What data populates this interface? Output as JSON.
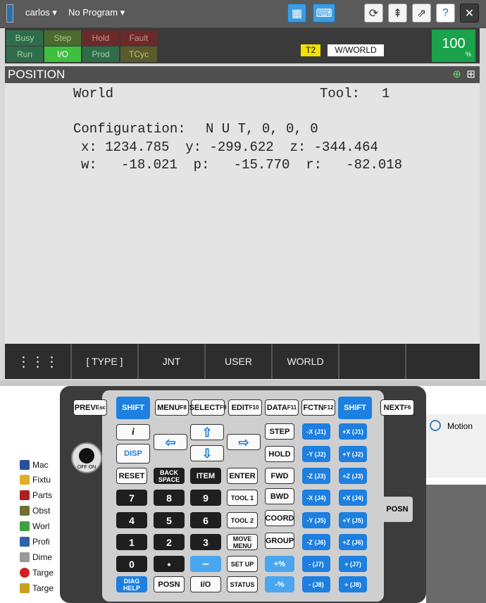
{
  "topbar": {
    "user": "carlos",
    "program": "No Program"
  },
  "status": {
    "row1": [
      "Busy",
      "Step",
      "Hold",
      "Fault"
    ],
    "row2": [
      "Run",
      "I/O",
      "Prod",
      "TCyc"
    ],
    "mode": "T2",
    "frame": "W/WORLD",
    "override": "100",
    "override_unit": "%"
  },
  "screen": {
    "title": "POSITION",
    "coord": "World",
    "tool_label": "Tool:",
    "tool_value": "1",
    "config_label": "Configuration:",
    "config_value": "N U T, 0, 0, 0",
    "line_xyz": "x: 1234.785  y: -299.622  z: -344.464",
    "line_wpr": "w:   -18.021  p:   -15.770  r:   -82.018"
  },
  "fkeys": [
    "[ TYPE ]",
    "JNT",
    "USER",
    "WORLD",
    "",
    ""
  ],
  "tree": [
    "Mac",
    "Fixtu",
    "Parts",
    "Obst",
    "Worl",
    "Profi",
    "Dime",
    "Targe",
    "Targe"
  ],
  "motion_label": "Motion",
  "keys": {
    "prev": "PREV",
    "prev_sub": "Esc",
    "shift": "SHIFT",
    "menu": "MENU",
    "menu_sub": "F8",
    "select": "SELECT",
    "select_sub": "F9",
    "edit": "EDIT",
    "edit_sub": "F10",
    "data": "DATA",
    "data_sub": "F11",
    "fctn": "FCTN",
    "fctn_sub": "F12",
    "next": "NEXT",
    "next_sub": "F6",
    "info": "i",
    "disp": "DISP",
    "step": "STEP",
    "hold": "HOLD",
    "fwd": "FWD",
    "bwd": "BWD",
    "coord": "COORD",
    "group": "GROUP",
    "reset": "RESET",
    "backspace": "BACK SPACE",
    "item": "ITEM",
    "enter": "ENTER",
    "tool1": "TOOL 1",
    "tool2": "TOOL 2",
    "movemenu": "MOVE MENU",
    "setup": "SET UP",
    "diaghelp": "DIAG HELP",
    "posn": "POSN",
    "io": "I/O",
    "status": "STATUS",
    "offon": "OFF  ON",
    "side_posn": "POSN",
    "nums": [
      "7",
      "8",
      "9",
      "4",
      "5",
      "6",
      "1",
      "2",
      "3",
      "0",
      "•"
    ],
    "plus_pct": "+%",
    "minus_pct": "-%",
    "jog_minus": [
      "-X (J1)",
      "-Y (J2)",
      "-Z (J3)",
      "-X (J4)",
      "-Y (J5)",
      "-Z (J6)",
      "- (J7)",
      "- (J8)"
    ],
    "jog_plus": [
      "+X (J1)",
      "+Y (J2)",
      "+Z (J3)",
      "+X (J4)",
      "+Y (J5)",
      "+Z (J6)",
      "+ (J7)",
      "+ (J8)"
    ]
  }
}
